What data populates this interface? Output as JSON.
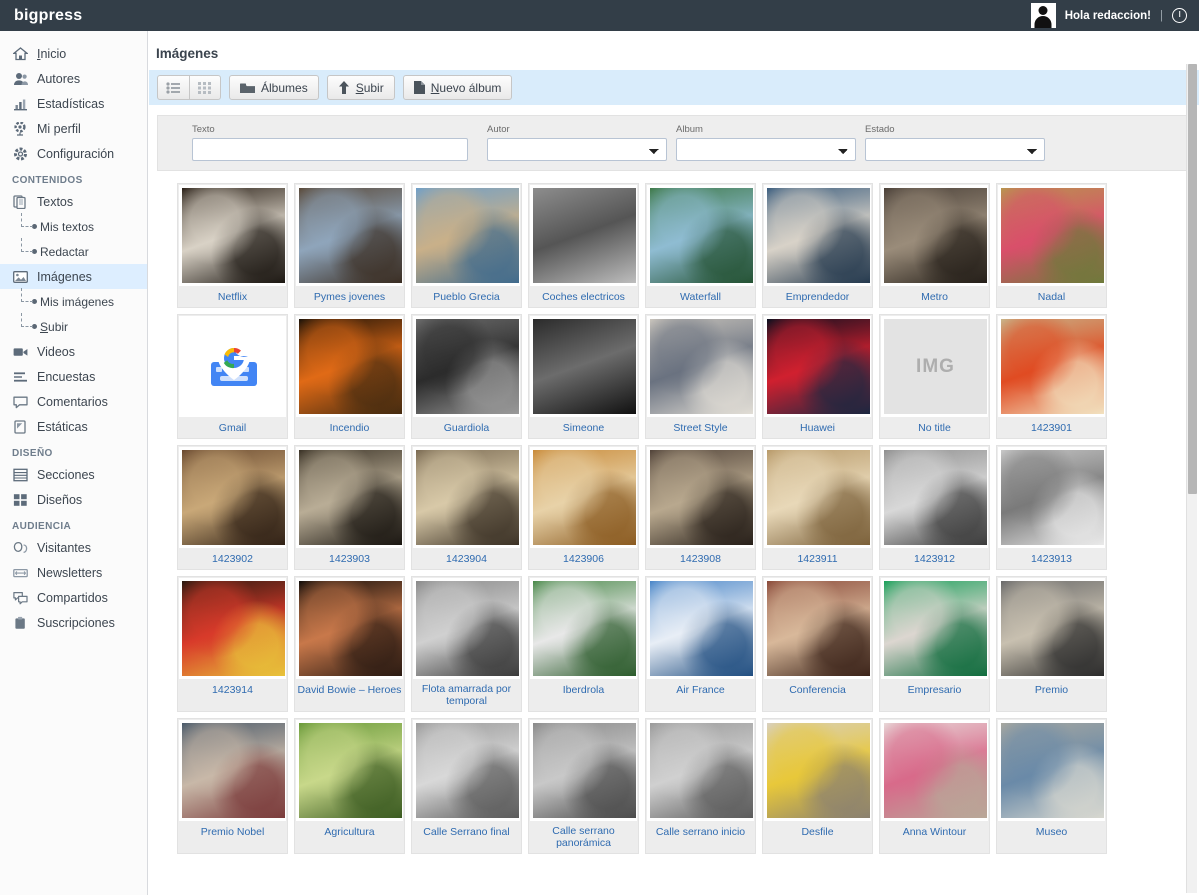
{
  "header": {
    "brand": "bigpress",
    "greeting": "Hola redaccion!",
    "separator": "|",
    "avatar_icon": "user-avatar-icon",
    "power_icon": "power-icon"
  },
  "sidebar": {
    "items": [
      {
        "label": "Inicio",
        "icon": "home-icon",
        "underline": "I",
        "active": false
      },
      {
        "label": "Autores",
        "icon": "users-icon",
        "active": false
      },
      {
        "label": "Estadísticas",
        "icon": "chart-icon",
        "active": false
      },
      {
        "label": "Mi perfil",
        "icon": "profile-gear-icon",
        "active": false
      },
      {
        "label": "Configuración",
        "icon": "gear-icon",
        "active": false
      }
    ],
    "sections": [
      {
        "title": "CONTENIDOS",
        "items": [
          {
            "label": "Textos",
            "icon": "documents-icon",
            "active": false,
            "children": [
              {
                "label": "Mis textos"
              },
              {
                "label": "Redactar"
              }
            ]
          },
          {
            "label": "Imágenes",
            "icon": "image-icon",
            "active": true,
            "children": [
              {
                "label": "Mis imágenes"
              },
              {
                "label": "Subir",
                "underline": "S"
              }
            ]
          },
          {
            "label": "Videos",
            "icon": "video-icon",
            "active": false,
            "children": []
          },
          {
            "label": "Encuestas",
            "icon": "poll-icon",
            "active": false,
            "children": []
          },
          {
            "label": "Comentarios",
            "icon": "comment-icon",
            "active": false,
            "children": []
          },
          {
            "label": "Estáticas",
            "icon": "page-icon",
            "active": false,
            "children": []
          }
        ]
      },
      {
        "title": "DISEÑO",
        "items": [
          {
            "label": "Secciones",
            "icon": "list-rows-icon",
            "active": false,
            "children": []
          },
          {
            "label": "Diseños",
            "icon": "grid-squares-icon",
            "active": false,
            "children": []
          }
        ]
      },
      {
        "title": "AUDIENCIA",
        "items": [
          {
            "label": "Visitantes",
            "icon": "visitors-icon",
            "active": false,
            "children": []
          },
          {
            "label": "Newsletters",
            "icon": "envelope-icon",
            "active": false,
            "children": []
          },
          {
            "label": "Compartidos",
            "icon": "share-bubbles-icon",
            "active": false,
            "children": []
          },
          {
            "label": "Suscripciones",
            "icon": "clipboard-icon",
            "active": false,
            "children": []
          }
        ]
      }
    ]
  },
  "main": {
    "page_title": "Imágenes",
    "toolbar": {
      "view_list_icon": "list-view-icon",
      "view_grid_icon": "grid-view-icon",
      "albums_label": "Álbumes",
      "albums_icon": "folder-icon",
      "upload_label": "Subir",
      "upload_underline": "S",
      "upload_icon": "upload-arrow-icon",
      "new_album_label": "Nuevo álbum",
      "new_album_underline": "N",
      "new_album_icon": "file-icon"
    },
    "filters": {
      "texto_label": "Texto",
      "texto_value": "",
      "texto_placeholder": "",
      "autor_label": "Autor",
      "autor_value": "",
      "album_label": "Album",
      "album_value": "",
      "estado_label": "Estado",
      "estado_value": ""
    },
    "gallery": [
      {
        "caption": "Netflix",
        "kind": "photo",
        "colors": [
          "#2b2118",
          "#d9d2c6",
          "#1a1510"
        ]
      },
      {
        "caption": "Pymes jovenes",
        "kind": "photo",
        "colors": [
          "#5a4a3a",
          "#8fa5bb",
          "#3a2d22"
        ]
      },
      {
        "caption": "Pueblo Grecia",
        "kind": "photo",
        "colors": [
          "#6f9fc8",
          "#c9b089",
          "#3f6a8c"
        ]
      },
      {
        "caption": "Coches electricos",
        "kind": "photo",
        "colors": [
          "#8d8d8d",
          "#555",
          "#bdbdbd"
        ]
      },
      {
        "caption": "Waterfall",
        "kind": "photo",
        "colors": [
          "#3f7a4a",
          "#8fbcd2",
          "#245233"
        ]
      },
      {
        "caption": "Emprendedor",
        "kind": "photo",
        "colors": [
          "#3b5d7e",
          "#d8d2c8",
          "#23384d"
        ]
      },
      {
        "caption": "Metro",
        "kind": "photo",
        "colors": [
          "#4a4038",
          "#9a8c7a",
          "#241e18"
        ]
      },
      {
        "caption": "Nadal",
        "kind": "photo",
        "colors": [
          "#b8964f",
          "#d94f6a",
          "#6d7a3a"
        ]
      },
      {
        "caption": "Gmail",
        "kind": "logo-gmail",
        "colors": [
          "#ffffff",
          "#4285f4",
          "#ffffff"
        ]
      },
      {
        "caption": "Incendio",
        "kind": "photo",
        "colors": [
          "#1b1208",
          "#e06a16",
          "#452b10"
        ]
      },
      {
        "caption": "Guardiola",
        "kind": "photo",
        "colors": [
          "#6d6d6d",
          "#2b2b2b",
          "#9a9a9a"
        ]
      },
      {
        "caption": "Simeone",
        "kind": "photo",
        "colors": [
          "#2b2b2b",
          "#6c6c6c",
          "#111"
        ]
      },
      {
        "caption": "Street Style",
        "kind": "photo",
        "colors": [
          "#c9c4bc",
          "#6a7280",
          "#e2ded6"
        ]
      },
      {
        "caption": "Huawei",
        "kind": "photo",
        "colors": [
          "#0a0f1e",
          "#d0202f",
          "#1a2740"
        ]
      },
      {
        "caption": "No title",
        "kind": "placeholder",
        "placeholder_text": "IMG",
        "colors": [
          "#e3e3e3"
        ]
      },
      {
        "caption": "1423901",
        "kind": "photo",
        "colors": [
          "#c8b58a",
          "#e04b22",
          "#f2e2c0"
        ]
      },
      {
        "caption": "1423902",
        "kind": "photo",
        "colors": [
          "#6a4a30",
          "#c9a878",
          "#2e1f14"
        ]
      },
      {
        "caption": "1423903",
        "kind": "photo",
        "colors": [
          "#3a3226",
          "#b9ad96",
          "#191510"
        ]
      },
      {
        "caption": "1423904",
        "kind": "photo",
        "colors": [
          "#7a6a52",
          "#d8c9a8",
          "#3a3024"
        ]
      },
      {
        "caption": "1423906",
        "kind": "photo",
        "colors": [
          "#c98b3a",
          "#e8d2a8",
          "#8a5a20"
        ]
      },
      {
        "caption": "1423908",
        "kind": "photo",
        "colors": [
          "#52443a",
          "#b8a88e",
          "#261e18"
        ]
      },
      {
        "caption": "1423911",
        "kind": "photo",
        "colors": [
          "#b89a6a",
          "#e8d8b8",
          "#7a5f38"
        ]
      },
      {
        "caption": "1423912",
        "kind": "photo",
        "colors": [
          "#8f8f8f",
          "#d8d8d8",
          "#3a3a3a"
        ]
      },
      {
        "caption": "1423913",
        "kind": "photo",
        "colors": [
          "#c8c8c8",
          "#7a7a7a",
          "#eaeaea"
        ]
      },
      {
        "caption": "1423914",
        "kind": "photo",
        "colors": [
          "#2a1a10",
          "#d83a2a",
          "#e8c43a"
        ]
      },
      {
        "caption": "David Bowie – Heroes",
        "kind": "photo",
        "colors": [
          "#120d0a",
          "#c8784a",
          "#2a1a12"
        ]
      },
      {
        "caption": "Flota amarrada por temporal",
        "kind": "photo",
        "colors": [
          "#8a8a8a",
          "#d0d0d0",
          "#3a3a3a"
        ]
      },
      {
        "caption": "Iberdrola",
        "kind": "photo",
        "colors": [
          "#4a8a4a",
          "#e8e8e8",
          "#2a5a2a"
        ]
      },
      {
        "caption": "Air France",
        "kind": "photo",
        "colors": [
          "#4a86c8",
          "#e8eef6",
          "#1f4d80"
        ]
      },
      {
        "caption": "Conferencia",
        "kind": "photo",
        "colors": [
          "#8a4a3a",
          "#d8b89a",
          "#3a2218"
        ]
      },
      {
        "caption": "Empresario",
        "kind": "photo",
        "colors": [
          "#1aa05a",
          "#dcd6d0",
          "#0e6b3c"
        ]
      },
      {
        "caption": "Premio",
        "kind": "photo",
        "colors": [
          "#6a6a6a",
          "#c8c0b0",
          "#2a2a2a"
        ]
      },
      {
        "caption": "Premio Nobel",
        "kind": "photo",
        "colors": [
          "#4a5a6a",
          "#c8b8a8",
          "#7a3a3a"
        ]
      },
      {
        "caption": "Agricultura",
        "kind": "photo",
        "colors": [
          "#6a9a3a",
          "#c8d88a",
          "#3a5a20"
        ]
      },
      {
        "caption": "Calle Serrano final",
        "kind": "photo",
        "colors": [
          "#9a9a9a",
          "#d8d8d8",
          "#5a5a5a"
        ]
      },
      {
        "caption": "Calle serrano panorámica",
        "kind": "photo",
        "colors": [
          "#8a8a8a",
          "#c8c8c8",
          "#4a4a4a"
        ]
      },
      {
        "caption": "Calle serrano inicio",
        "kind": "photo",
        "colors": [
          "#9a9a9a",
          "#d0d0d0",
          "#5a5a5a"
        ]
      },
      {
        "caption": "Desfile",
        "kind": "photo",
        "colors": [
          "#d8d0c0",
          "#e8c83a",
          "#8a8070"
        ]
      },
      {
        "caption": "Anna Wintour",
        "kind": "photo",
        "colors": [
          "#e8d8d8",
          "#d86a8a",
          "#b8a898"
        ]
      },
      {
        "caption": "Museo",
        "kind": "photo",
        "colors": [
          "#a8a8a0",
          "#6a8aa8",
          "#d8d8d0"
        ]
      }
    ]
  },
  "scrollbar": {
    "name": "vertical-scrollbar"
  }
}
